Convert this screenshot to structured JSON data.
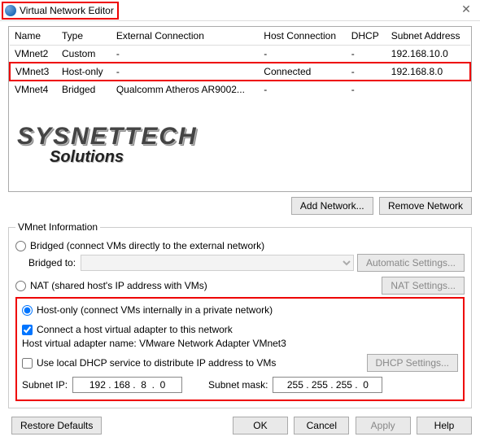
{
  "title": "Virtual Network Editor",
  "table": {
    "headers": {
      "name": "Name",
      "type": "Type",
      "ext": "External Connection",
      "host": "Host Connection",
      "dhcp": "DHCP",
      "subnet": "Subnet Address"
    },
    "rows": [
      {
        "name": "VMnet2",
        "type": "Custom",
        "ext": "-",
        "host": "-",
        "dhcp": "-",
        "subnet": "192.168.10.0"
      },
      {
        "name": "VMnet3",
        "type": "Host-only",
        "ext": "-",
        "host": "Connected",
        "dhcp": "-",
        "subnet": "192.168.8.0"
      },
      {
        "name": "VMnet4",
        "type": "Bridged",
        "ext": "Qualcomm Atheros AR9002...",
        "host": "-",
        "dhcp": "-",
        "subnet": ""
      }
    ]
  },
  "logo": {
    "l1": "SYSNETTECH",
    "l2": "Solutions"
  },
  "buttons": {
    "add": "Add Network...",
    "remove": "Remove Network",
    "auto": "Automatic Settings...",
    "nat": "NAT Settings...",
    "dhcp": "DHCP Settings...",
    "restore": "Restore Defaults",
    "ok": "OK",
    "cancel": "Cancel",
    "apply": "Apply",
    "help": "Help"
  },
  "info": {
    "legend": "VMnet Information",
    "bridged": "Bridged (connect VMs directly to the external network)",
    "bridged_to": "Bridged to:",
    "nat": "NAT (shared host's IP address with VMs)",
    "hostonly": "Host-only (connect VMs internally in a private network)",
    "connect_host": "Connect a host virtual adapter to this network",
    "adapter_name": "Host virtual adapter name: VMware Network Adapter VMnet3",
    "use_dhcp": "Use local DHCP service to distribute IP address to VMs",
    "subnet_ip_label": "Subnet IP:",
    "subnet_mask_label": "Subnet mask:",
    "subnet_ip": "192 . 168 .  8  .  0",
    "subnet_mask": "255 . 255 . 255 .  0"
  }
}
